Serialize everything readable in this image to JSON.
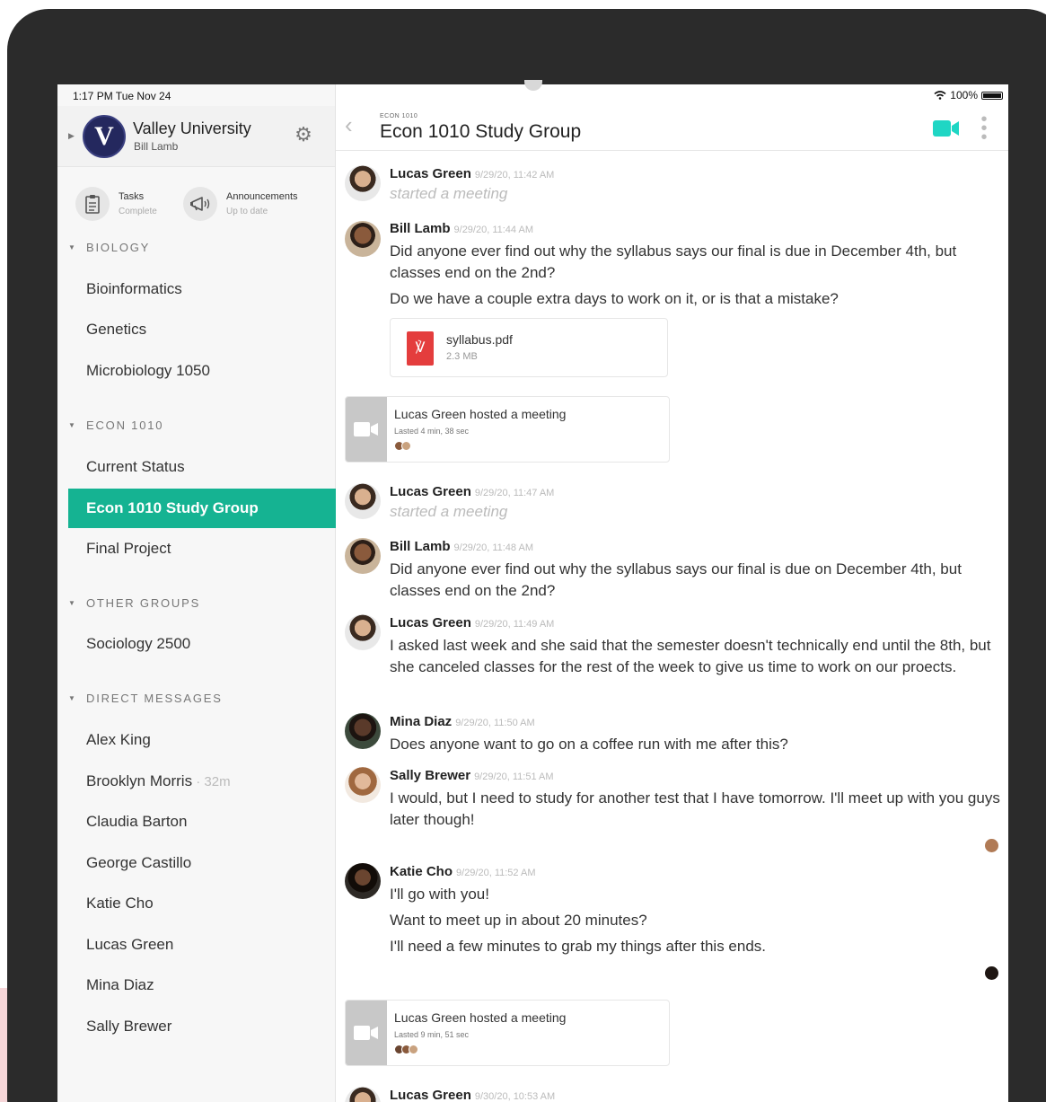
{
  "status_bar": {
    "time": "1:17 PM  Tue Nov 24",
    "battery": "100%"
  },
  "sidebar": {
    "org_initial": "V",
    "org_name": "Valley University",
    "user_name": "Bill Lamb",
    "quick": [
      {
        "label": "Tasks",
        "status": "Complete"
      },
      {
        "label": "Announcements",
        "status": "Up to date"
      }
    ],
    "sections": [
      {
        "label": "BIOLOGY",
        "items": [
          "Bioinformatics",
          "Genetics",
          "Microbiology 1050"
        ]
      },
      {
        "label": "ECON 1010",
        "items": [
          "Current Status",
          "Econ 1010 Study Group",
          "Final Project"
        ]
      },
      {
        "label": "OTHER GROUPS",
        "items": [
          "Sociology 2500"
        ]
      },
      {
        "label": "DIRECT MESSAGES",
        "items": [
          "Alex King",
          "Brooklyn Morris",
          "Claudia Barton",
          "George Castillo",
          "Katie Cho",
          "Lucas Green",
          "Mina Diaz",
          "Sally Brewer"
        ]
      }
    ],
    "dm_meta": " · 32m"
  },
  "main": {
    "breadcrumb": "ECON 1010",
    "title": "Econ 1010 Study Group",
    "messages": [
      {
        "name": "Lucas Green",
        "time": "9/29/20, 11:42 AM",
        "system": "started a meeting"
      },
      {
        "name": "Bill Lamb",
        "time": "9/29/20, 11:44 AM",
        "lines": [
          "Did anyone ever find out why the syllabus says our final is due in December 4th, but classes end on the 2nd?",
          "Do we have a couple extra days to work  on it, or is that a mistake?"
        ]
      },
      {
        "name": "Lucas Green",
        "time": "9/29/20, 11:47 AM",
        "system": "started a meeting"
      },
      {
        "name": "Bill Lamb",
        "time": "9/29/20, 11:48 AM",
        "lines": [
          "Did anyone ever find out why the syllabus says our final is due on December 4th, but classes end on the 2nd?"
        ]
      },
      {
        "name": "Lucas Green",
        "time": "9/29/20, 11:49 AM",
        "lines": [
          "I asked last week and she said that the semester doesn't technically end until the 8th, but she canceled classes for the rest of the week to give us time to work on our proects."
        ]
      },
      {
        "name": "Mina Diaz",
        "time": "9/29/20, 11:50 AM",
        "lines": [
          "Does anyone want to go on a coffee run with me after this?"
        ]
      },
      {
        "name": "Sally Brewer",
        "time": "9/29/20, 11:51 AM",
        "lines": [
          "I would, but I need to study for another test that I have tomorrow. I'll meet up with you guys later though!"
        ]
      },
      {
        "name": "Katie Cho",
        "time": "9/29/20, 11:52 AM",
        "lines": [
          "I'll go with you!",
          "Want to meet up in about 20 minutes?",
          "I'll need a few minutes to grab my things after this ends."
        ]
      },
      {
        "name": "Lucas Green",
        "time": "9/30/20, 10:53 AM"
      }
    ],
    "file": {
      "name": "syllabus.pdf",
      "size": "2.3 MB"
    },
    "meetings": [
      {
        "title": "Lucas Green hosted a meeting",
        "duration": "Lasted 4 min, 38 sec"
      },
      {
        "title": "Lucas Green hosted a meeting",
        "duration": "Lasted 9 min, 51 sec"
      }
    ]
  },
  "colors": {
    "accent": "#15b392",
    "video": "#1fd6c4",
    "pdf": "#e43d3d"
  }
}
